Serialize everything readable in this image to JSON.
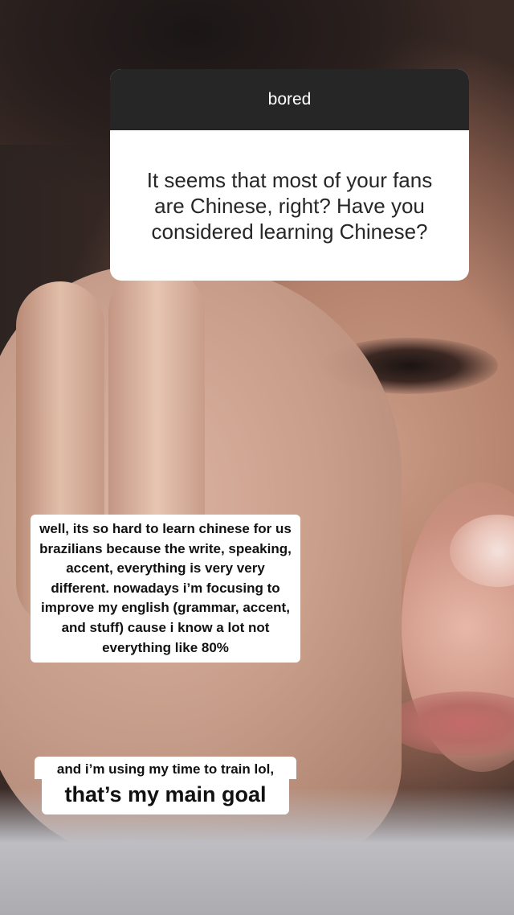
{
  "question": {
    "header": "bored",
    "text": "It seems that most of your fans are Chinese, right? Have you considered learning Chinese?"
  },
  "captions": {
    "answer_block": "well, its so hard to learn chinese for us brazilians because the write, speaking, accent, everything is very very different. nowadays i’m focusing to improve my english (grammar, accent, and stuff) cause i know a lot not everything like 80%",
    "line_small": "and i’m using my time to train lol,",
    "line_large": "that’s my main goal"
  }
}
